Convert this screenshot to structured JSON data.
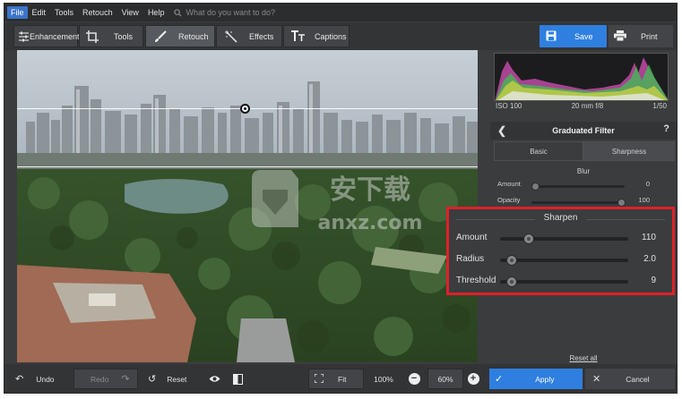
{
  "menu": {
    "items": [
      "File",
      "Edit",
      "Tools",
      "Retouch",
      "View",
      "Help"
    ],
    "search_placeholder": "What do you want to do?"
  },
  "toolbar": {
    "tabs": [
      {
        "label": "Enhancement",
        "icon": "sliders-icon"
      },
      {
        "label": "Tools",
        "icon": "crop-icon"
      },
      {
        "label": "Retouch",
        "icon": "brush-icon",
        "active": true
      },
      {
        "label": "Effects",
        "icon": "magic-wand-icon"
      },
      {
        "label": "Captions",
        "icon": "text-icon"
      }
    ],
    "save_label": "Save",
    "print_label": "Print"
  },
  "histogram": {
    "iso": "ISO 100",
    "lens": "20 mm f/8",
    "shutter": "1/50"
  },
  "panel": {
    "title": "Graduated Filter",
    "help": "?",
    "tabs": [
      "Basic",
      "Sharpness"
    ],
    "active_tab": "Sharpness",
    "blur": {
      "title": "Blur",
      "amount_label": "Amount",
      "amount_value": "0",
      "opacity_label": "Opacity",
      "opacity_value": "100"
    },
    "sharpen": {
      "title": "Sharpen",
      "amount_label": "Amount",
      "amount_value": "110",
      "amount_level": 0.2,
      "radius_label": "Radius",
      "radius_value": "2.0",
      "radius_level": 0.05,
      "threshold_label": "Threshold",
      "threshold_value": "9",
      "threshold_level": 0.05
    },
    "reset_all": "Reset all"
  },
  "bottombar": {
    "undo": "Undo",
    "redo": "Redo",
    "reset": "Reset",
    "fit": "Fit",
    "zoom_100": "100%",
    "zoom_value": "60%",
    "apply": "Apply",
    "cancel": "Cancel"
  },
  "colors": {
    "accent": "#2f7fe0",
    "highlight": "#e0202a",
    "background": "#3b3c3e"
  }
}
